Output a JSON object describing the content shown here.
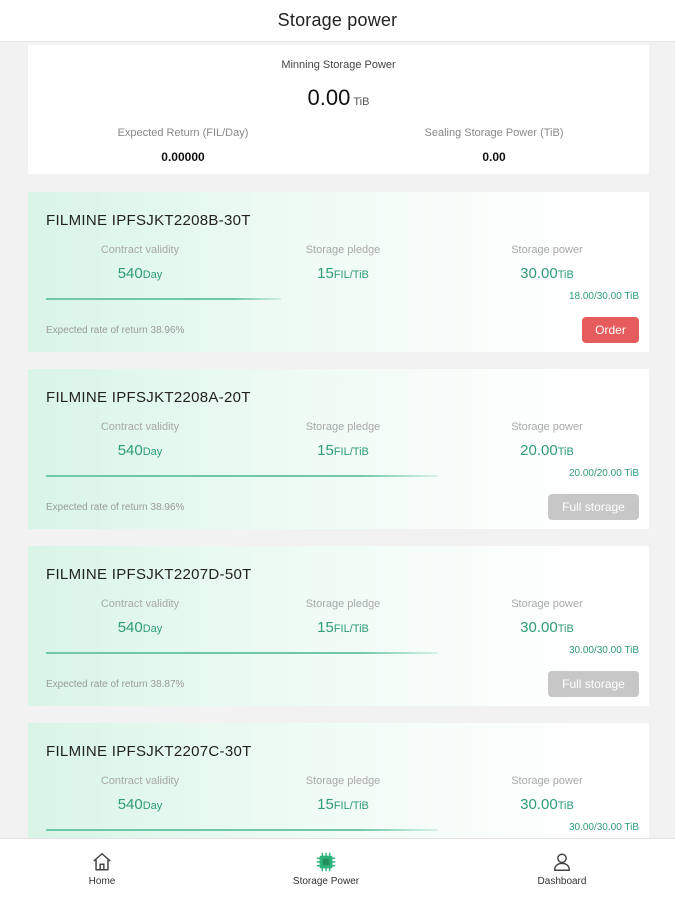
{
  "header": {
    "title": "Storage power"
  },
  "summary": {
    "main_label": "Minning Storage Power",
    "main_value": "0.00",
    "main_unit": "TiB",
    "expected_return_label": "Expected Return (FIL/Day)",
    "expected_return_value": "0.00000",
    "sealing_label": "Sealing Storage Power (TiB)",
    "sealing_value": "0.00"
  },
  "cards": [
    {
      "name": "FILMINE IPFSJKT2208B-30T",
      "validity_label": "Contract validity",
      "validity_value": "540",
      "validity_unit": "Day",
      "pledge_label": "Storage pledge",
      "pledge_value": "15",
      "pledge_unit": "FIL/TiB",
      "power_label": "Storage power",
      "power_value": "30.00",
      "power_unit": "TiB",
      "power_progress_text": "18.00/30.00 TiB",
      "progress_fraction": 0.6,
      "rate_text": "Expected rate of return 38.96%",
      "button_label": "Order",
      "button_state": "order"
    },
    {
      "name": "FILMINE IPFSJKT2208A-20T",
      "validity_label": "Contract validity",
      "validity_value": "540",
      "validity_unit": "Day",
      "pledge_label": "Storage pledge",
      "pledge_value": "15",
      "pledge_unit": "FIL/TiB",
      "power_label": "Storage power",
      "power_value": "20.00",
      "power_unit": "TiB",
      "power_progress_text": "20.00/20.00 TiB",
      "progress_fraction": 1.0,
      "rate_text": "Expected rate of return 38.96%",
      "button_label": "Full storage",
      "button_state": "full"
    },
    {
      "name": "FILMINE IPFSJKT2207D-50T",
      "validity_label": "Contract validity",
      "validity_value": "540",
      "validity_unit": "Day",
      "pledge_label": "Storage pledge",
      "pledge_value": "15",
      "pledge_unit": "FIL/TiB",
      "power_label": "Storage power",
      "power_value": "30.00",
      "power_unit": "TiB",
      "power_progress_text": "30.00/30.00 TiB",
      "progress_fraction": 1.0,
      "rate_text": "Expected rate of return 38.87%",
      "button_label": "Full storage",
      "button_state": "full"
    },
    {
      "name": "FILMINE IPFSJKT2207C-30T",
      "validity_label": "Contract validity",
      "validity_value": "540",
      "validity_unit": "Day",
      "pledge_label": "Storage pledge",
      "pledge_value": "15",
      "pledge_unit": "FIL/TiB",
      "power_label": "Storage power",
      "power_value": "30.00",
      "power_unit": "TiB",
      "power_progress_text": "30.00/30.00 TiB",
      "progress_fraction": 1.0,
      "rate_text": "",
      "button_label": "",
      "button_state": "hidden"
    }
  ],
  "tabbar": {
    "home_label": "Home",
    "home_icon": "home-icon",
    "storage_label": "Storage Power",
    "storage_icon": "chip-icon",
    "dashboard_label": "Dashboard",
    "dashboard_icon": "user-icon"
  },
  "colors": {
    "accent": "#2f9b77",
    "order_button": "#e65c5c",
    "full_button": "#c7c7c7",
    "active_tab": "#2db37a"
  }
}
